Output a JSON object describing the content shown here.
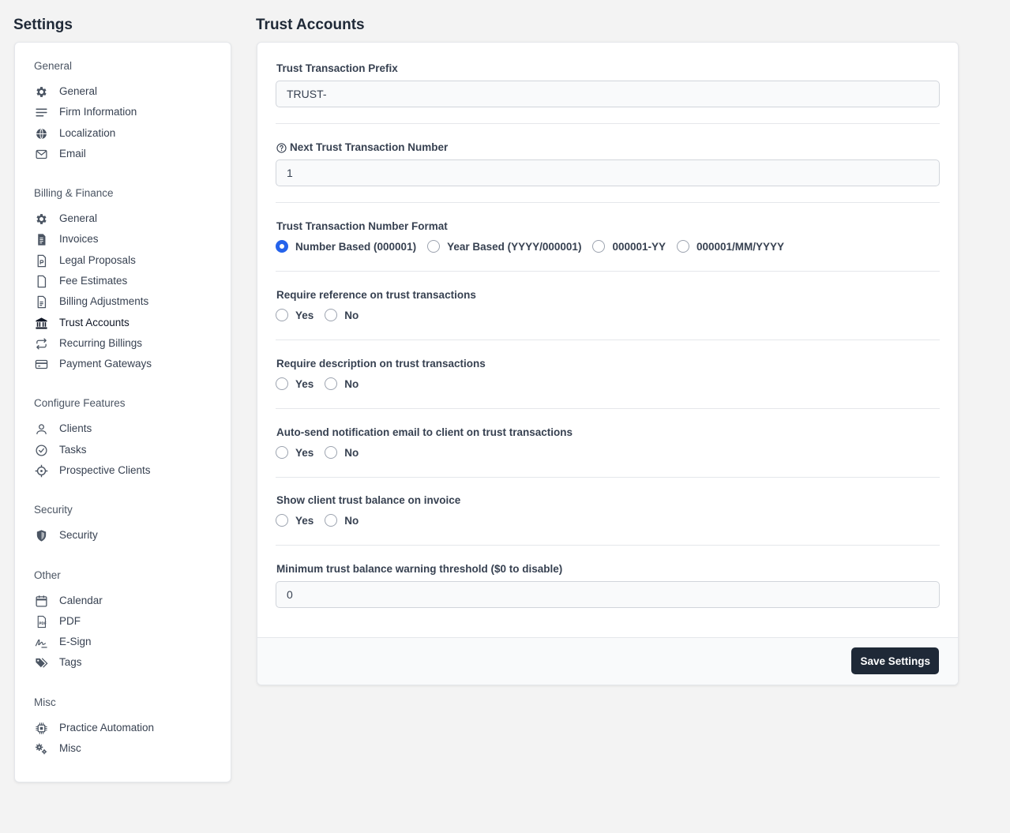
{
  "sidebar": {
    "title": "Settings",
    "groups": [
      {
        "label": "General",
        "items": [
          {
            "label": "General",
            "icon": "gear-icon"
          },
          {
            "label": "Firm Information",
            "icon": "lines-icon"
          },
          {
            "label": "Localization",
            "icon": "globe-icon"
          },
          {
            "label": "Email",
            "icon": "envelope-icon"
          }
        ]
      },
      {
        "label": "Billing & Finance",
        "items": [
          {
            "label": "General",
            "icon": "gear-icon"
          },
          {
            "label": "Invoices",
            "icon": "invoice-icon"
          },
          {
            "label": "Legal Proposals",
            "icon": "proposal-icon"
          },
          {
            "label": "Fee Estimates",
            "icon": "file-icon"
          },
          {
            "label": "Billing Adjustments",
            "icon": "file-text-icon"
          },
          {
            "label": "Trust Accounts",
            "icon": "bank-icon"
          },
          {
            "label": "Recurring Billings",
            "icon": "repeat-icon"
          },
          {
            "label": "Payment Gateways",
            "icon": "credit-card-icon"
          }
        ]
      },
      {
        "label": "Configure Features",
        "items": [
          {
            "label": "Clients",
            "icon": "user-icon"
          },
          {
            "label": "Tasks",
            "icon": "check-circle-icon"
          },
          {
            "label": "Prospective Clients",
            "icon": "crosshair-icon"
          }
        ]
      },
      {
        "label": "Security",
        "items": [
          {
            "label": "Security",
            "icon": "shield-icon"
          }
        ]
      },
      {
        "label": "Other",
        "items": [
          {
            "label": "Calendar",
            "icon": "calendar-icon"
          },
          {
            "label": "PDF",
            "icon": "pdf-icon"
          },
          {
            "label": "E-Sign",
            "icon": "signature-icon"
          },
          {
            "label": "Tags",
            "icon": "tags-icon"
          }
        ]
      },
      {
        "label": "Misc",
        "items": [
          {
            "label": "Practice Automation",
            "icon": "chip-icon"
          },
          {
            "label": "Misc",
            "icon": "gears-icon"
          }
        ]
      }
    ],
    "active": "Trust Accounts"
  },
  "main": {
    "title": "Trust Accounts",
    "prefix": {
      "label": "Trust Transaction Prefix",
      "value": "TRUST-"
    },
    "next_number": {
      "label": "Next Trust Transaction Number",
      "value": "1",
      "icon": "question-circle-icon"
    },
    "format": {
      "label": "Trust Transaction Number Format",
      "options": [
        "Number Based (000001)",
        "Year Based (YYYY/000001)",
        "000001-YY",
        "000001/MM/YYYY"
      ],
      "selected": "Number Based (000001)"
    },
    "yes_no": [
      {
        "label": "Require reference on trust transactions"
      },
      {
        "label": "Require description on trust transactions"
      },
      {
        "label": "Auto-send notification email to client on trust transactions"
      },
      {
        "label": "Show client trust balance on invoice"
      }
    ],
    "yes_label": "Yes",
    "no_label": "No",
    "threshold": {
      "label": "Minimum trust balance warning threshold ($0 to disable)",
      "value": "0"
    },
    "save_label": "Save Settings"
  },
  "colors": {
    "accent": "#2563eb",
    "button": "#1f2937",
    "background": "#f3f3f3"
  }
}
